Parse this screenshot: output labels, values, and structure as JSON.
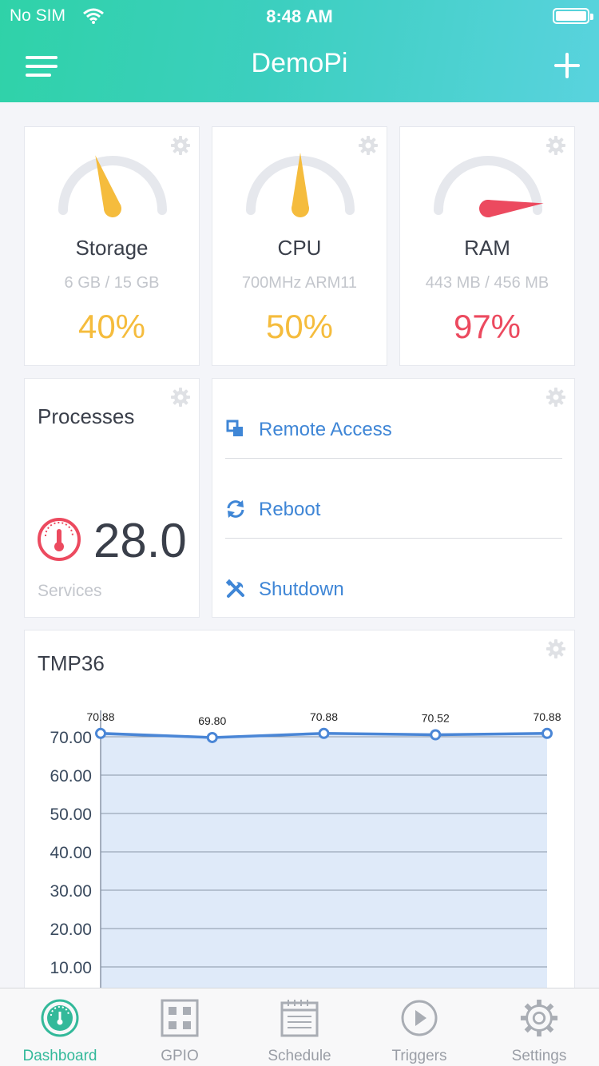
{
  "status_bar": {
    "carrier": "No SIM",
    "time": "8:48 AM"
  },
  "header": {
    "title": "DemoPi"
  },
  "gauges": [
    {
      "label": "Storage",
      "detail": "6 GB / 15 GB",
      "value": "40%",
      "percent": 40,
      "color": "#f5bc3d"
    },
    {
      "label": "CPU",
      "detail": "700MHz ARM11",
      "value": "50%",
      "percent": 50,
      "color": "#f5bc3d"
    },
    {
      "label": "RAM",
      "detail": "443 MB / 456 MB",
      "value": "97%",
      "percent": 97,
      "color": "#ec4a5f"
    }
  ],
  "processes": {
    "title": "Processes",
    "value": "28.0",
    "caption": "Services"
  },
  "actions": [
    {
      "label": "Remote Access",
      "icon": "remote-access-icon"
    },
    {
      "label": "Reboot",
      "icon": "reboot-icon"
    },
    {
      "label": "Shutdown",
      "icon": "tools-icon"
    }
  ],
  "tmp": {
    "title": "TMP36"
  },
  "chart_data": {
    "type": "area",
    "title": "TMP36",
    "x": [
      1,
      2,
      3,
      4,
      5
    ],
    "y_tick_labels": [
      "70.00",
      "60.00",
      "50.00",
      "40.00",
      "30.00",
      "20.00",
      "10.00"
    ],
    "series": [
      {
        "values": [
          70.88,
          69.8,
          70.88,
          70.52,
          70.88
        ],
        "labels": [
          "70.88",
          "69.80",
          "70.88",
          "70.52",
          "70.88"
        ]
      }
    ],
    "ylim": [
      0,
      75
    ],
    "grid": true,
    "line_color": "#4a86d6",
    "fill_color": "#dfeaf9"
  },
  "tabs": [
    {
      "label": "Dashboard",
      "icon": "dashboard-gauge-icon",
      "active": true
    },
    {
      "label": "GPIO",
      "icon": "gpio-grid-icon"
    },
    {
      "label": "Schedule",
      "icon": "calendar-icon"
    },
    {
      "label": "Triggers",
      "icon": "play-circle-icon"
    },
    {
      "label": "Settings",
      "icon": "gear-icon"
    }
  ],
  "colors": {
    "accent": "#33b99a",
    "link": "#3f86d6",
    "warn": "#f5bc3d",
    "danger": "#ec4a5f"
  }
}
